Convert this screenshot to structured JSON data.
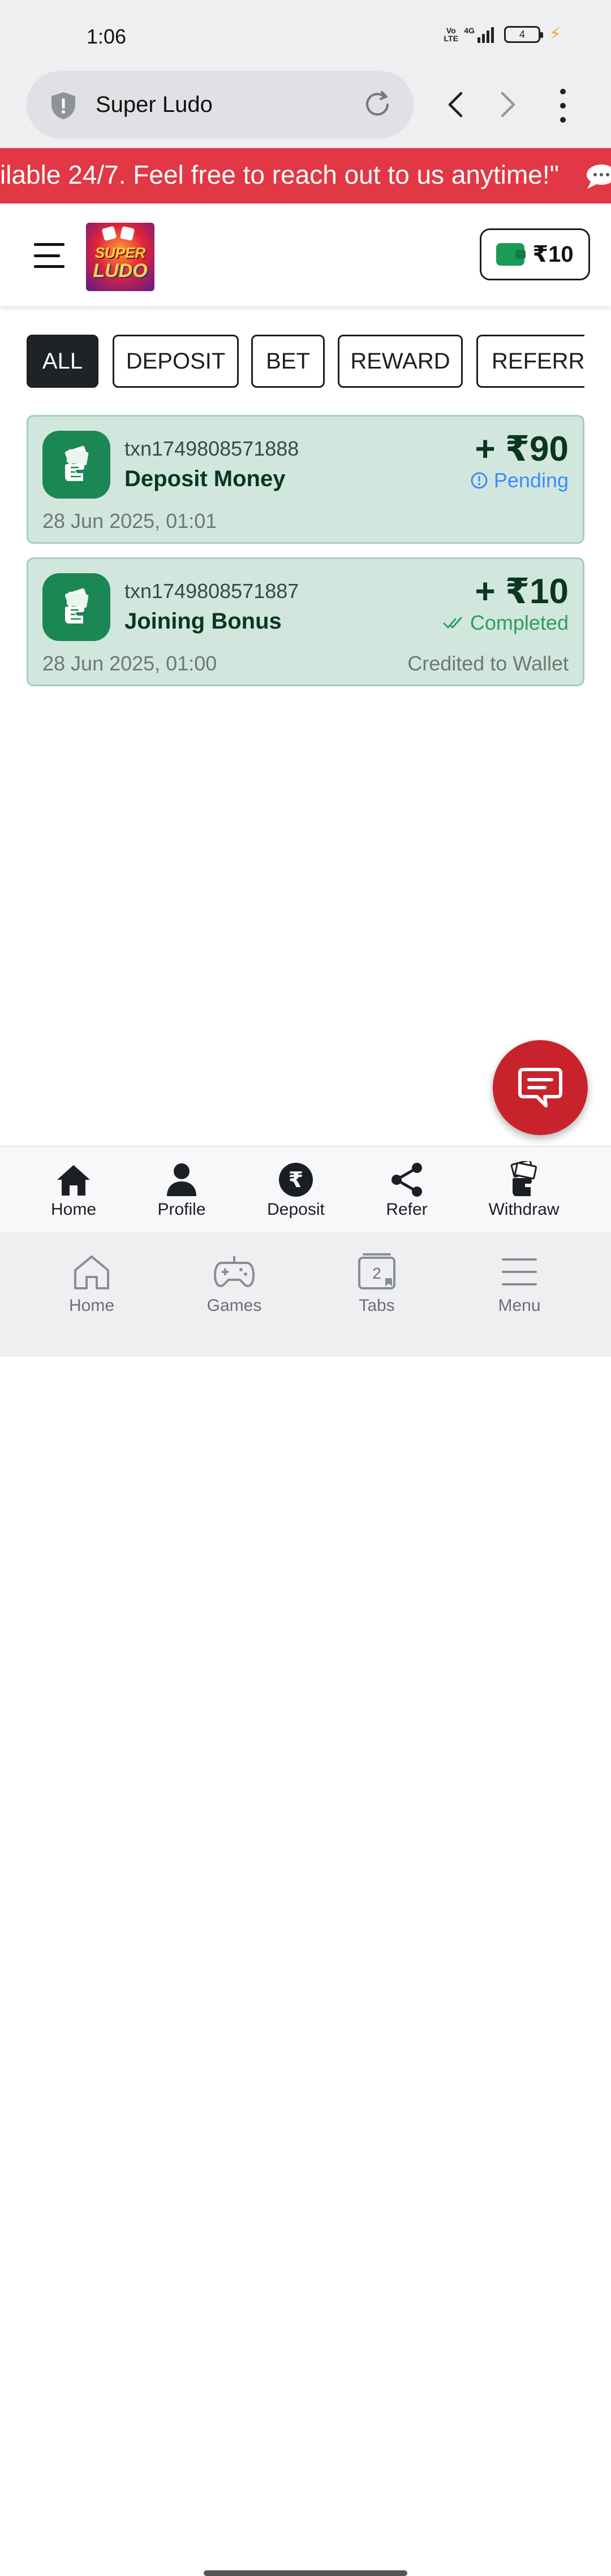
{
  "status_bar": {
    "time": "1:06",
    "volte": "Vo LTE",
    "network": "4G",
    "battery": "4"
  },
  "browser": {
    "title": "Super Ludo"
  },
  "marquee": {
    "text": "ilable 24/7. Feel free to reach out to us anytime!\""
  },
  "header": {
    "logo_text_top": "SUPER",
    "logo_text_bottom": "LUDO",
    "wallet_amount": "₹10"
  },
  "filters": [
    {
      "label": "ALL",
      "active": true
    },
    {
      "label": "DEPOSIT",
      "active": false
    },
    {
      "label": "BET",
      "active": false
    },
    {
      "label": "REWARD",
      "active": false
    },
    {
      "label": "REFERRA",
      "active": false
    }
  ],
  "transactions": [
    {
      "id": "txn1749808571888",
      "title": "Deposit Money",
      "amount": "+ ₹90",
      "status": "Pending",
      "date": "28 Jun 2025, 01:01",
      "note": ""
    },
    {
      "id": "txn1749808571887",
      "title": "Joining Bonus",
      "amount": "+ ₹10",
      "status": "Completed",
      "date": "28 Jun 2025, 01:00",
      "note": "Credited to Wallet"
    }
  ],
  "app_nav": [
    {
      "label": "Home",
      "icon": "home-icon"
    },
    {
      "label": "Profile",
      "icon": "person-icon"
    },
    {
      "label": "Deposit",
      "icon": "rupee-icon"
    },
    {
      "label": "Refer",
      "icon": "share-icon"
    },
    {
      "label": "Withdraw",
      "icon": "cash-icon"
    }
  ],
  "browser_nav": [
    {
      "label": "Home",
      "icon": "home-outline-icon"
    },
    {
      "label": "Games",
      "icon": "gamepad-icon"
    },
    {
      "label": "Tabs",
      "icon": "tabs-icon",
      "count": "2"
    },
    {
      "label": "Menu",
      "icon": "menu-icon"
    }
  ],
  "colors": {
    "marquee_bg": "#e23744",
    "txn_bg": "#d1e7dd",
    "icon_green": "#1a8754",
    "pending": "#3d8bfd",
    "completed": "#2e9e63",
    "fab": "#c8232c"
  }
}
